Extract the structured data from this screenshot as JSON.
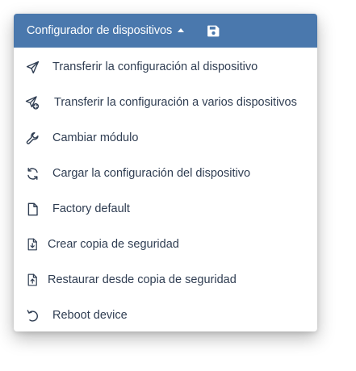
{
  "header": {
    "title": "Configurador de dispositivos",
    "background": "#4a78ad",
    "caret_icon": "caret-up-icon",
    "save_icon": "floppy-disk-icon"
  },
  "menu": {
    "items": [
      {
        "label": "Transferir la configuración al dispositivo",
        "icon": "paper-plane-icon"
      },
      {
        "label": "Transferir la configuración a varios dispositivos",
        "icon": "paper-plane-plus-icon"
      },
      {
        "label": "Cambiar módulo",
        "icon": "wrench-icon"
      },
      {
        "label": "Cargar la configuración del dispositivo",
        "icon": "sync-icon"
      },
      {
        "label": "Factory default",
        "icon": "file-icon"
      },
      {
        "label": "Crear copia de seguridad",
        "icon": "file-download-icon"
      },
      {
        "label": "Restaurar desde copia de seguridad",
        "icon": "file-upload-icon"
      },
      {
        "label": "Reboot device",
        "icon": "undo-icon"
      }
    ],
    "text_color": "#2f3d52"
  }
}
